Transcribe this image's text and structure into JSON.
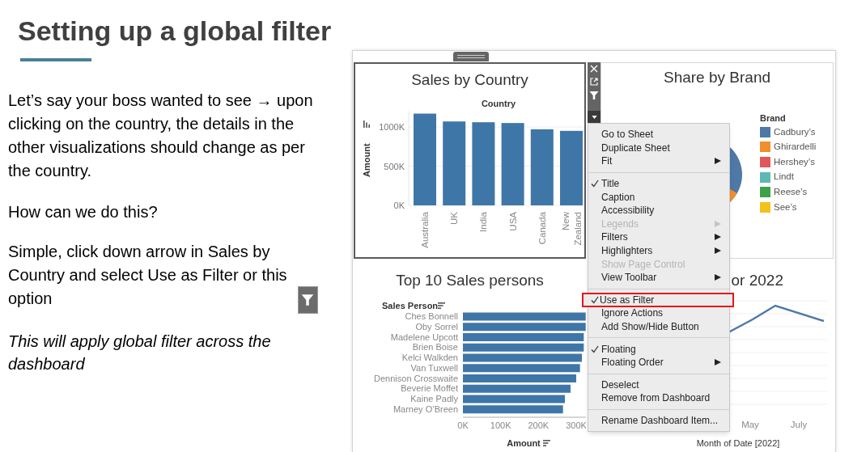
{
  "slide": {
    "title": "Setting up a global filter",
    "paragraphs": [
      {
        "kind": "text",
        "text": "Let’s say your boss wanted to see → upon clicking on the country, the details in the other visualizations should change as per the country."
      },
      {
        "kind": "text",
        "text": "How can we do this?"
      },
      {
        "kind": "text-with-icon",
        "text": "Simple, click down arrow in Sales by Country and select Use as Filter or this option"
      },
      {
        "kind": "italic",
        "text": "This will apply global filter across the dashboard"
      }
    ]
  },
  "dashboard": {
    "sales_by_country": {
      "title": "Sales by Country",
      "selected": true,
      "header": "Country",
      "chart_data": {
        "type": "bar",
        "orientation": "vertical",
        "ylabel": "Amount",
        "categories": [
          "Australia",
          "UK",
          "India",
          "USA",
          "Canada",
          "New Zealand"
        ],
        "series": [
          {
            "color": "#3f76a8",
            "values": [
              1170000,
              1070000,
              1060000,
              1050000,
              970000,
              950000
            ]
          }
        ],
        "ylim": [
          0,
          1200000
        ],
        "yticks": [
          {
            "value": 0,
            "label": "0K"
          },
          {
            "value": 500000,
            "label": "500K"
          },
          {
            "value": 1000000,
            "label": "1000K"
          }
        ]
      }
    },
    "share_by_brand": {
      "title": "Share by Brand",
      "legend": {
        "title": "Brand",
        "items": [
          {
            "label": "Cadbury’s",
            "color": "#4e79a7"
          },
          {
            "label": "Ghirardelli",
            "color": "#f28e2b"
          },
          {
            "label": "Hershey’s",
            "color": "#e15759"
          },
          {
            "label": "Lindt",
            "color": "#5fb8b0"
          },
          {
            "label": "Reese’s",
            "color": "#3fa04a"
          },
          {
            "label": "See’s",
            "color": "#f1c21b"
          }
        ]
      }
    },
    "top_sales_persons": {
      "title": "Top 10 Sales persons",
      "row_header": "Sales Person",
      "chart_data": {
        "type": "bar",
        "orientation": "horizontal",
        "xlabel": "Amount",
        "categories": [
          "Ches Bonnell",
          "Oby Sorrel",
          "Madelene Upcott",
          "Brien Boise",
          "Kelci Walkden",
          "Van Tuxwell",
          "Dennison Crosswaite",
          "Beverie Moffet",
          "Kaine Padly",
          "Marney O’Breen"
        ],
        "series": [
          {
            "color": "#3f76a8",
            "values": [
              325000,
              325000,
              320000,
              320000,
              315000,
              310000,
              300000,
              285000,
              270000,
              265000
            ]
          }
        ],
        "xlim": [
          0,
          325000
        ],
        "xticks": [
          {
            "value": 0,
            "label": "0K"
          },
          {
            "value": 100000,
            "label": "100K"
          },
          {
            "value": 200000,
            "label": "200K"
          },
          {
            "value": 300000,
            "label": "300K"
          }
        ]
      }
    },
    "trend": {
      "title": "or 2022",
      "x_labels": [
        "May",
        "July"
      ],
      "x_axis_title": "Month of Date [2022]"
    },
    "context_menu": {
      "groups": [
        [
          {
            "label": "Go to Sheet",
            "checked": false,
            "disabled": false,
            "submenu": false,
            "highlighted": false
          },
          {
            "label": "Duplicate Sheet",
            "checked": false,
            "disabled": false,
            "submenu": false,
            "highlighted": false
          },
          {
            "label": "Fit",
            "checked": false,
            "disabled": false,
            "submenu": true,
            "highlighted": false
          }
        ],
        [
          {
            "label": "Title",
            "checked": true,
            "disabled": false,
            "submenu": false,
            "highlighted": false
          },
          {
            "label": "Caption",
            "checked": false,
            "disabled": false,
            "submenu": false,
            "highlighted": false
          },
          {
            "label": "Accessibility",
            "checked": false,
            "disabled": false,
            "submenu": false,
            "highlighted": false
          },
          {
            "label": "Legends",
            "checked": false,
            "disabled": true,
            "submenu": true,
            "highlighted": false
          },
          {
            "label": "Filters",
            "checked": false,
            "disabled": false,
            "submenu": true,
            "highlighted": false
          },
          {
            "label": "Highlighters",
            "checked": false,
            "disabled": false,
            "submenu": true,
            "highlighted": false
          },
          {
            "label": "Show Page Control",
            "checked": false,
            "disabled": true,
            "submenu": false,
            "highlighted": false
          },
          {
            "label": "View Toolbar",
            "checked": false,
            "disabled": false,
            "submenu": true,
            "highlighted": false
          }
        ],
        [
          {
            "label": "Use as Filter",
            "checked": true,
            "disabled": false,
            "submenu": false,
            "highlighted": true
          },
          {
            "label": "Ignore Actions",
            "checked": false,
            "disabled": false,
            "submenu": false,
            "highlighted": false
          },
          {
            "label": "Add Show/Hide Button",
            "checked": false,
            "disabled": false,
            "submenu": false,
            "highlighted": false
          }
        ],
        [
          {
            "label": "Floating",
            "checked": true,
            "disabled": false,
            "submenu": false,
            "highlighted": false
          },
          {
            "label": "Floating Order",
            "checked": false,
            "disabled": false,
            "submenu": true,
            "highlighted": false
          }
        ],
        [
          {
            "label": "Deselect",
            "checked": false,
            "disabled": false,
            "submenu": false,
            "highlighted": false
          },
          {
            "label": "Remove from Dashboard",
            "checked": false,
            "disabled": false,
            "submenu": false,
            "highlighted": false
          }
        ],
        [
          {
            "label": "Rename Dashboard Item...",
            "checked": false,
            "disabled": false,
            "submenu": false,
            "highlighted": false
          }
        ]
      ]
    }
  }
}
